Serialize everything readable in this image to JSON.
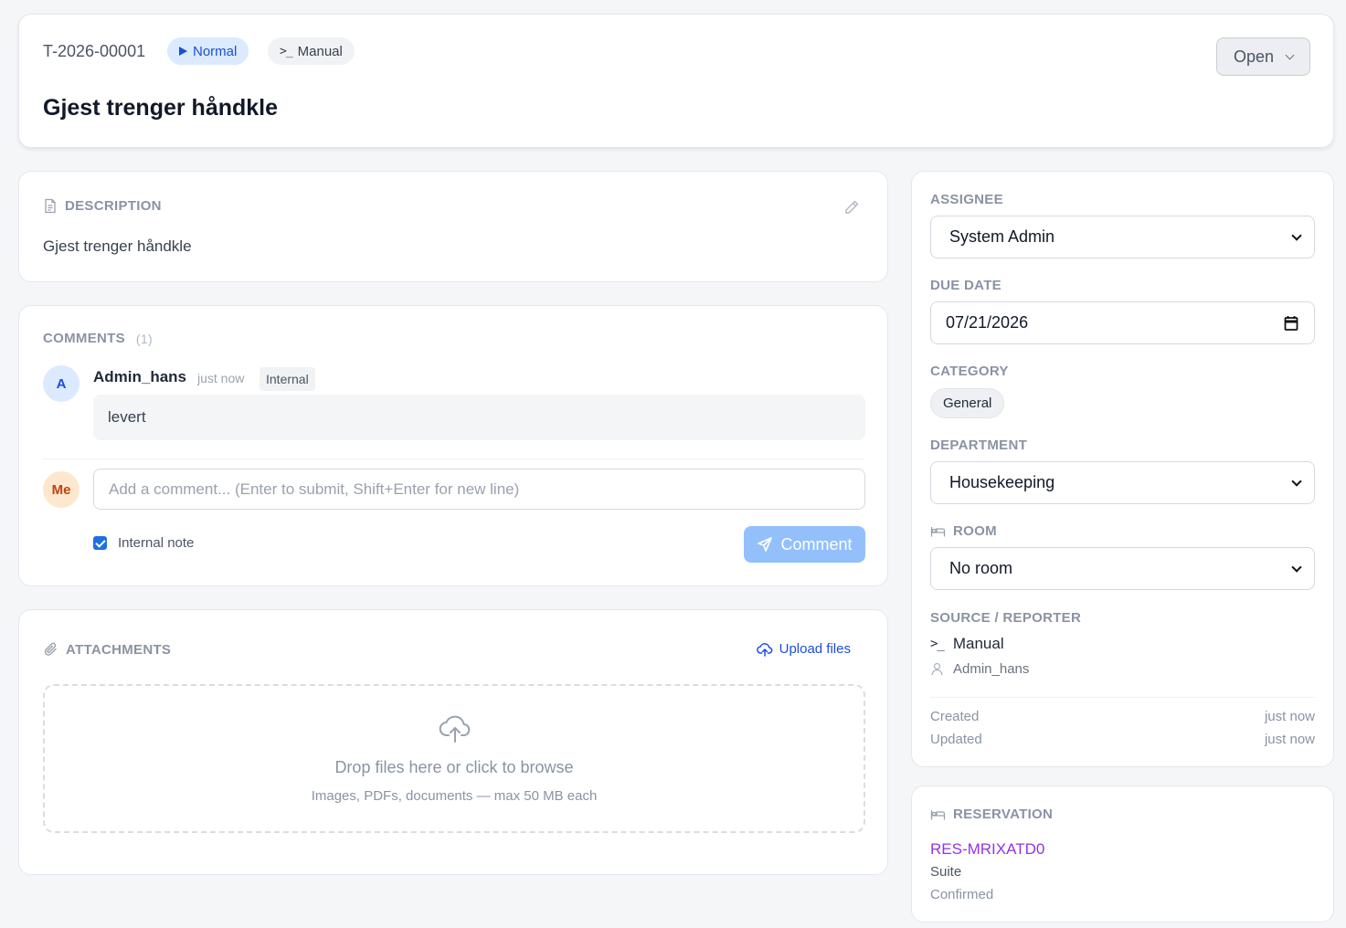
{
  "ticket": {
    "id": "T-2026-00001",
    "priority": "Normal",
    "source": "Manual",
    "status": "Open",
    "title": "Gjest trenger håndkle"
  },
  "description": {
    "label": "DESCRIPTION",
    "text": "Gjest trenger håndkle"
  },
  "comments": {
    "label": "COMMENTS",
    "count": "(1)",
    "items": [
      {
        "avatar": "A",
        "author": "Admin_hans",
        "time": "just now",
        "tag": "Internal",
        "body": "levert"
      }
    ],
    "my_avatar": "Me",
    "input_placeholder": "Add a comment... (Enter to submit, Shift+Enter for new line)",
    "internal_note_label": "Internal note",
    "internal_note_checked": true,
    "submit_label": "Comment"
  },
  "attachments": {
    "label": "ATTACHMENTS",
    "upload_label": "Upload files",
    "drop_title": "Drop files here or click to browse",
    "drop_subtitle": "Images, PDFs, documents — max 50 MB each"
  },
  "sidebar": {
    "assignee_label": "ASSIGNEE",
    "assignee_value": "System Admin",
    "due_date_label": "DUE DATE",
    "due_date_value": "07/21/2026",
    "category_label": "CATEGORY",
    "category_value": "General",
    "department_label": "DEPARTMENT",
    "department_value": "Housekeeping",
    "room_label": "ROOM",
    "room_value": "No room",
    "source_label": "SOURCE / REPORTER",
    "source_value": "Manual",
    "reporter_value": "Admin_hans",
    "created_label": "Created",
    "created_value": "just now",
    "updated_label": "Updated",
    "updated_value": "just now"
  },
  "reservation": {
    "label": "RESERVATION",
    "id": "RES-MRIXATD0",
    "room_type": "Suite",
    "status": "Confirmed"
  },
  "colors": {
    "accent": "#1d4ed8",
    "comment_button": "#93c0fb",
    "reservation_link": "#9333ea",
    "page_background": "#f5f6f8"
  }
}
